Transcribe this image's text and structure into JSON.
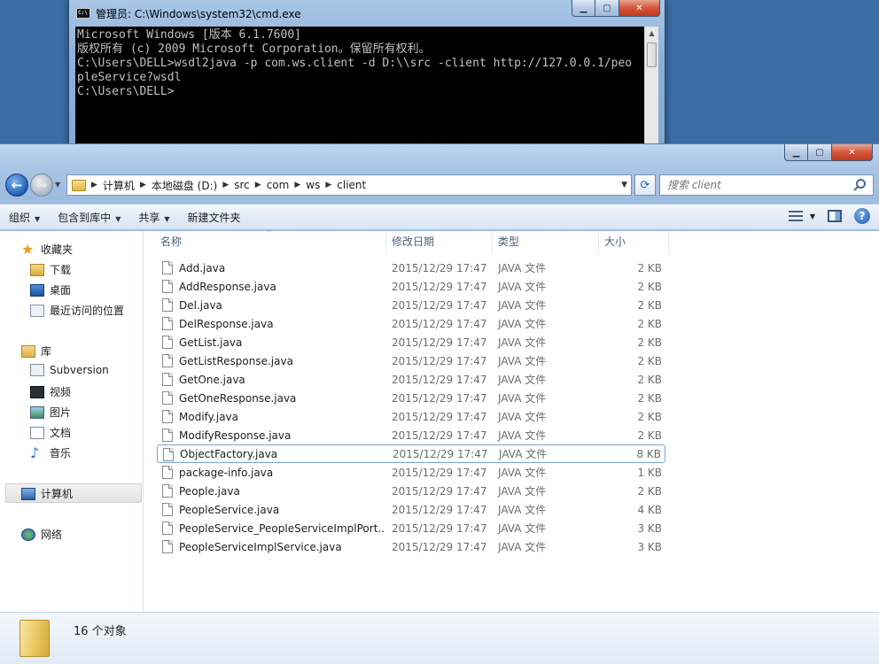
{
  "cmd": {
    "title": "管理员: C:\\Windows\\system32\\cmd.exe",
    "icon_label": "C:\\",
    "lines": [
      "Microsoft Windows [版本 6.1.7600]",
      "版权所有 (c) 2009 Microsoft Corporation。保留所有权利。",
      "",
      "C:\\Users\\DELL>wsdl2java -p com.ws.client -d D:\\\\src -client http://127.0.0.1/peo",
      "pleService?wsdl",
      "",
      "C:\\Users\\DELL>"
    ]
  },
  "caption_buttons": {
    "min": "▁",
    "max": "▢",
    "close": "✕"
  },
  "explorer": {
    "breadcrumbs": [
      "计算机",
      "本地磁盘 (D:)",
      "src",
      "com",
      "ws",
      "client"
    ],
    "search_placeholder": "搜索 client",
    "toolbar": {
      "organize": "组织",
      "include_in_library": "包含到库中",
      "share": "共享",
      "new_folder": "新建文件夹"
    },
    "nav": {
      "favorites": "收藏夹",
      "downloads": "下载",
      "desktop": "桌面",
      "recent": "最近访问的位置",
      "libraries": "库",
      "subversion": "Subversion",
      "videos": "视频",
      "pictures": "图片",
      "documents": "文档",
      "music": "音乐",
      "computer": "计算机",
      "network": "网络"
    },
    "columns": {
      "name": "名称",
      "date": "修改日期",
      "type": "类型",
      "size": "大小"
    },
    "files": [
      {
        "name": "Add.java",
        "date": "2015/12/29 17:47",
        "type": "JAVA 文件",
        "size": "2 KB"
      },
      {
        "name": "AddResponse.java",
        "date": "2015/12/29 17:47",
        "type": "JAVA 文件",
        "size": "2 KB"
      },
      {
        "name": "Del.java",
        "date": "2015/12/29 17:47",
        "type": "JAVA 文件",
        "size": "2 KB"
      },
      {
        "name": "DelResponse.java",
        "date": "2015/12/29 17:47",
        "type": "JAVA 文件",
        "size": "2 KB"
      },
      {
        "name": "GetList.java",
        "date": "2015/12/29 17:47",
        "type": "JAVA 文件",
        "size": "2 KB"
      },
      {
        "name": "GetListResponse.java",
        "date": "2015/12/29 17:47",
        "type": "JAVA 文件",
        "size": "2 KB"
      },
      {
        "name": "GetOne.java",
        "date": "2015/12/29 17:47",
        "type": "JAVA 文件",
        "size": "2 KB"
      },
      {
        "name": "GetOneResponse.java",
        "date": "2015/12/29 17:47",
        "type": "JAVA 文件",
        "size": "2 KB"
      },
      {
        "name": "Modify.java",
        "date": "2015/12/29 17:47",
        "type": "JAVA 文件",
        "size": "2 KB"
      },
      {
        "name": "ModifyResponse.java",
        "date": "2015/12/29 17:47",
        "type": "JAVA 文件",
        "size": "2 KB"
      },
      {
        "name": "ObjectFactory.java",
        "date": "2015/12/29 17:47",
        "type": "JAVA 文件",
        "size": "8 KB"
      },
      {
        "name": "package-info.java",
        "date": "2015/12/29 17:47",
        "type": "JAVA 文件",
        "size": "1 KB"
      },
      {
        "name": "People.java",
        "date": "2015/12/29 17:47",
        "type": "JAVA 文件",
        "size": "2 KB"
      },
      {
        "name": "PeopleService.java",
        "date": "2015/12/29 17:47",
        "type": "JAVA 文件",
        "size": "4 KB"
      },
      {
        "name": "PeopleService_PeopleServiceImplPort...",
        "date": "2015/12/29 17:47",
        "type": "JAVA 文件",
        "size": "3 KB"
      },
      {
        "name": "PeopleServiceImplService.java",
        "date": "2015/12/29 17:47",
        "type": "JAVA 文件",
        "size": "3 KB"
      }
    ],
    "selected_file": "ObjectFactory.java",
    "status": "16 个对象"
  }
}
